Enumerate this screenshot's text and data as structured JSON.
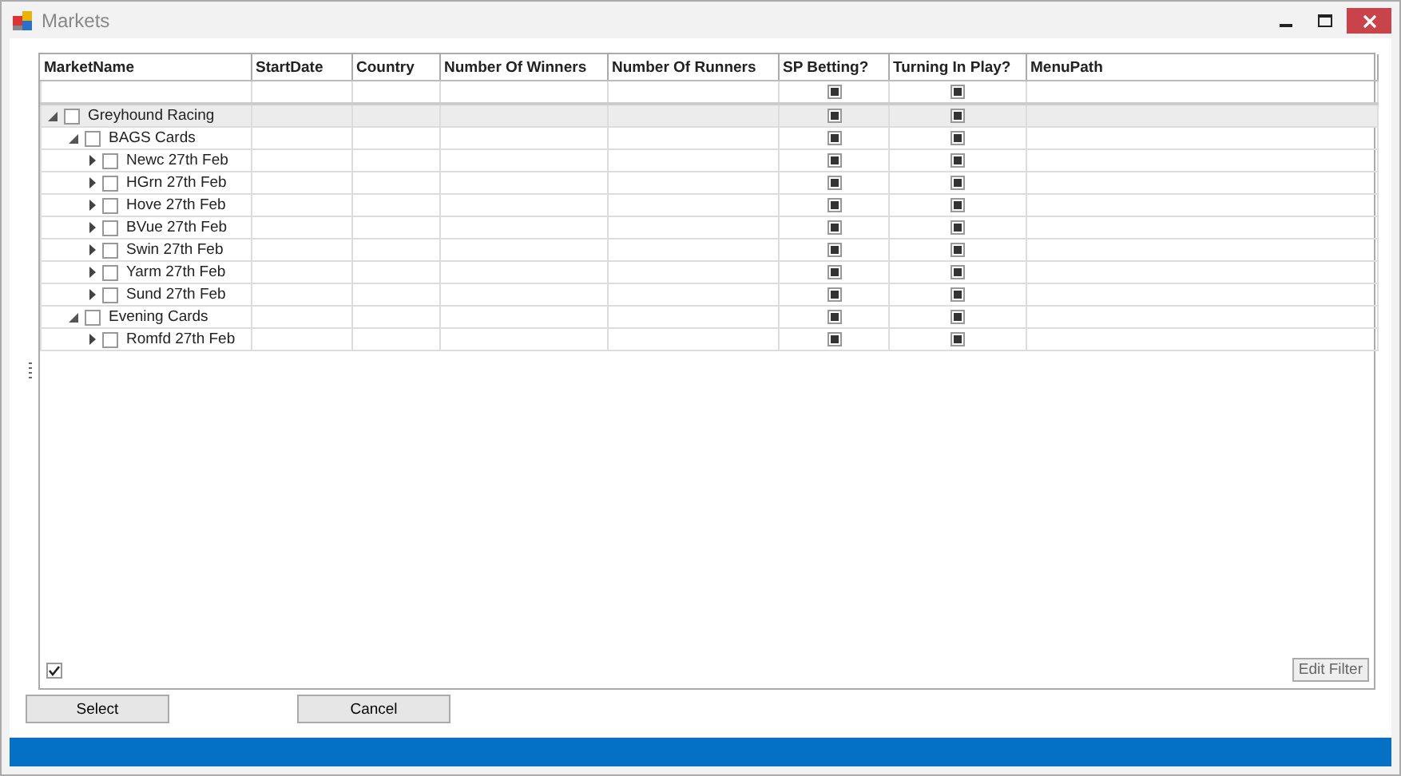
{
  "window": {
    "title": "Markets"
  },
  "grid": {
    "columns": [
      "MarketName",
      "StartDate",
      "Country",
      "Number Of Winners",
      "Number Of Runners",
      "SP Betting?",
      "Turning In Play?",
      "MenuPath"
    ],
    "filter_row": {
      "sp_betting_indeterminate": true,
      "turning_in_play_indeterminate": true
    },
    "tree": [
      {
        "name": "Greyhound Racing",
        "checked": false,
        "expanded": true,
        "selected": true,
        "sp_betting_indeterminate": true,
        "turning_in_play_indeterminate": true,
        "children": [
          {
            "name": "BAGS Cards",
            "checked": false,
            "expanded": true,
            "selected": false,
            "sp_betting_indeterminate": true,
            "turning_in_play_indeterminate": true,
            "children": [
              {
                "name": "Newc 27th Feb",
                "checked": false,
                "expanded": false,
                "selected": false,
                "sp_betting_indeterminate": true,
                "turning_in_play_indeterminate": true
              },
              {
                "name": "HGrn 27th Feb",
                "checked": false,
                "expanded": false,
                "selected": false,
                "sp_betting_indeterminate": true,
                "turning_in_play_indeterminate": true
              },
              {
                "name": "Hove 27th Feb",
                "checked": false,
                "expanded": false,
                "selected": false,
                "sp_betting_indeterminate": true,
                "turning_in_play_indeterminate": true
              },
              {
                "name": "BVue 27th Feb",
                "checked": false,
                "expanded": false,
                "selected": false,
                "sp_betting_indeterminate": true,
                "turning_in_play_indeterminate": true
              },
              {
                "name": "Swin 27th Feb",
                "checked": false,
                "expanded": false,
                "selected": false,
                "sp_betting_indeterminate": true,
                "turning_in_play_indeterminate": true
              },
              {
                "name": "Yarm 27th Feb",
                "checked": false,
                "expanded": false,
                "selected": false,
                "sp_betting_indeterminate": true,
                "turning_in_play_indeterminate": true
              },
              {
                "name": "Sund 27th Feb",
                "checked": false,
                "expanded": false,
                "selected": false,
                "sp_betting_indeterminate": true,
                "turning_in_play_indeterminate": true
              }
            ]
          },
          {
            "name": "Evening Cards",
            "checked": false,
            "expanded": true,
            "selected": false,
            "sp_betting_indeterminate": true,
            "turning_in_play_indeterminate": true,
            "children": [
              {
                "name": "Romfd 27th Feb",
                "checked": false,
                "expanded": false,
                "selected": false,
                "sp_betting_indeterminate": true,
                "turning_in_play_indeterminate": true
              }
            ]
          }
        ]
      }
    ]
  },
  "footer": {
    "checkbox_checked": true,
    "edit_filter_button": "Edit Filter"
  },
  "buttons": [
    "Select",
    "Cancel"
  ]
}
